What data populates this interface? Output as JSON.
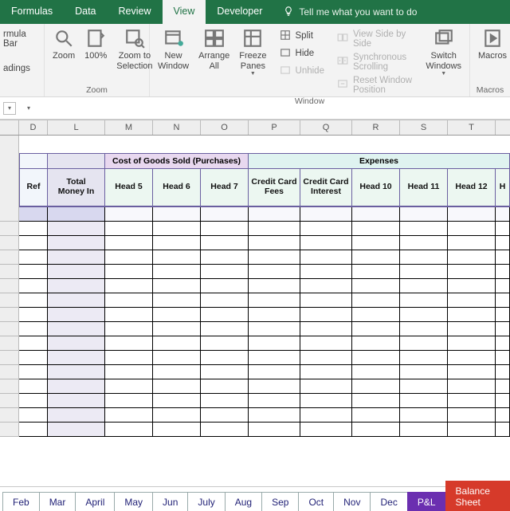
{
  "ribbonTabs": {
    "formulas": "Formulas",
    "data": "Data",
    "review": "Review",
    "view": "View",
    "developer": "Developer"
  },
  "tellMe": "Tell me what you want to do",
  "showGroup": {
    "formulaBar": "rmula Bar",
    "headings": "adings"
  },
  "zoomGroup": {
    "zoom": "Zoom",
    "hundred": "100%",
    "zoomToSel": "Zoom to\nSelection",
    "label": "Zoom"
  },
  "windowGroup": {
    "newWindow": "New\nWindow",
    "arrangeAll": "Arrange\nAll",
    "freeze": "Freeze\nPanes",
    "split": "Split",
    "hide": "Hide",
    "unhide": "Unhide",
    "viewSide": "View Side by Side",
    "syncScroll": "Synchronous Scrolling",
    "resetPos": "Reset Window Position",
    "switch": "Switch\nWindows",
    "label": "Window"
  },
  "macrosGroup": {
    "macros": "Macros",
    "label": "Macros"
  },
  "columns": [
    "D",
    "L",
    "M",
    "N",
    "O",
    "P",
    "Q",
    "R",
    "S",
    "T"
  ],
  "headers": {
    "ref": "Ref",
    "totalMoneyIn": "Total\nMoney In",
    "cogsBand": "Cost of Goods Sold (Purchases)",
    "cogs": [
      "Head 5",
      "Head 6",
      "Head 7"
    ],
    "expBand": "Expenses",
    "exp": [
      "Credit Card Fees",
      "Credit Card Interest",
      "Head 10",
      "Head 11",
      "Head 12"
    ]
  },
  "sheetTabs": [
    "Feb",
    "Mar",
    "April",
    "May",
    "Jun",
    "July",
    "Aug",
    "Sep",
    "Oct",
    "Nov",
    "Dec",
    "P&L",
    "Balance Sheet"
  ]
}
